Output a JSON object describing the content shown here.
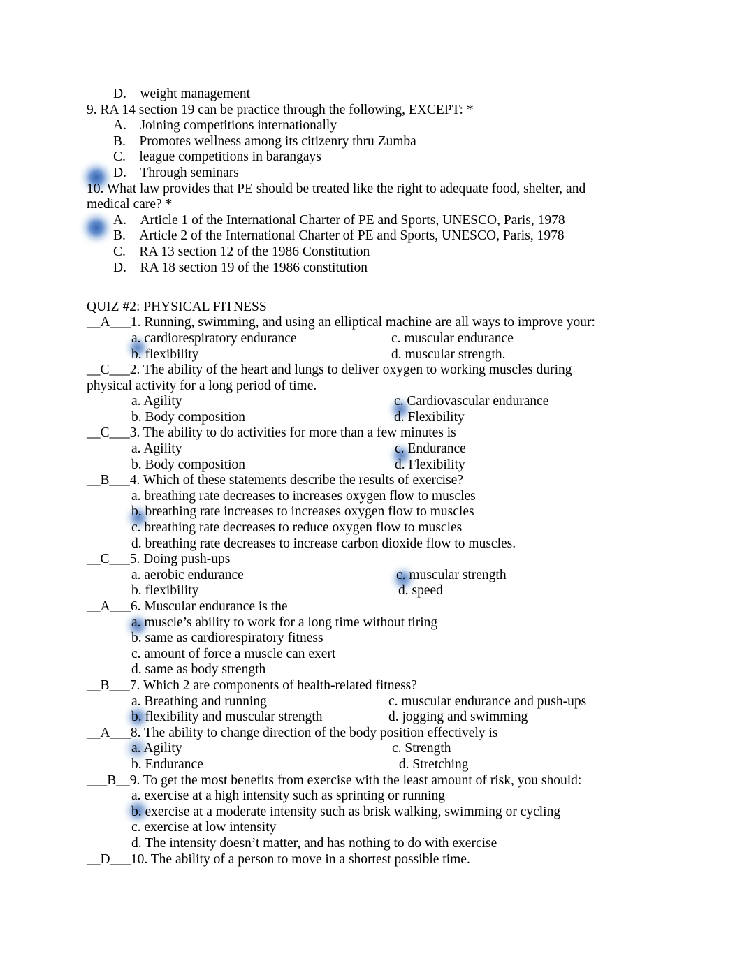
{
  "document": {
    "part1": {
      "trailing_option": "D. weight management",
      "questions": [
        {
          "number": "9.",
          "text": "RA 14 section 19 can be practice through the following, EXCEPT: *",
          "options": [
            "A. Joining competitions internationally",
            "B. Promotes wellness among its citizenry thru Zumba",
            "C. league competitions in barangays",
            "D. Through seminars"
          ]
        },
        {
          "number": "10.",
          "text": "What law provides that PE should be treated like the right to adequate food, shelter, and medical care? *",
          "options": [
            "A. Article 1 of the International Charter of PE and Sports, UNESCO, Paris, 1978",
            "B. Article 2 of the International Charter of PE and Sports, UNESCO, Paris, 1978",
            "C. RA 13 section 12 of the 1986 Constitution",
            "D. RA 18 section 19 of the 1986 constitution"
          ]
        }
      ]
    },
    "quiz2": {
      "title": "QUIZ #2: PHYSICAL FITNESS",
      "items": [
        {
          "blank": "__A___",
          "number": "1.",
          "stem": "Running, swimming, and using an elliptical machine are all ways to improve your:",
          "stem_line2": "",
          "rows": [
            {
              "left": "a. cardiorespiratory endurance",
              "right": "c. muscular endurance"
            },
            {
              "left": "b. flexibility",
              "right": "d. muscular strength."
            }
          ],
          "highlight": "a-left"
        },
        {
          "blank": "__C___",
          "number": "2.",
          "stem": "The ability of the heart and lungs to deliver oxygen to working muscles during",
          "stem_line2": "physical activity for a long period of time.",
          "rows": [
            {
              "left": "a. Agility",
              "right": "c. Cardiovascular endurance"
            },
            {
              "left": "b. Body composition",
              "right": "d. Flexibility"
            }
          ],
          "highlight": "c-right"
        },
        {
          "blank": "__C___",
          "number": "3.",
          "stem": "The ability to do activities for more than a few minutes is",
          "stem_line2": "",
          "rows": [
            {
              "left": "a. Agility",
              "right": "c. Endurance"
            },
            {
              "left": "b. Body composition",
              "right": "d. Flexibility"
            }
          ],
          "highlight": "c-right"
        },
        {
          "blank": "__B___",
          "number": "4.",
          "stem": "Which of these statements describe the results of exercise?",
          "stem_line2": "",
          "rows": [
            {
              "left": "a. breathing rate decreases to increases oxygen flow to muscles",
              "right": ""
            },
            {
              "left": "b. breathing rate increases to increases oxygen flow to muscles",
              "right": ""
            },
            {
              "left": "c. breathing rate decreases to reduce oxygen flow to muscles",
              "right": ""
            },
            {
              "left": "d. breathing rate decreases to increase carbon dioxide flow to muscles.",
              "right": ""
            }
          ],
          "highlight": "b-left"
        },
        {
          "blank": "__C___",
          "number": "5.",
          "stem": "Doing push-ups",
          "stem_line2": "",
          "rows": [
            {
              "left": "a. aerobic endurance",
              "right": "c. muscular strength"
            },
            {
              "left": "b. flexibility",
              "right": "d. speed"
            }
          ],
          "highlight": "c-right"
        },
        {
          "blank": "__A___",
          "number": "6.",
          "stem": "Muscular endurance is the",
          "stem_line2": "",
          "rows": [
            {
              "left": "a. muscle’s ability to work for a long time without tiring",
              "right": ""
            },
            {
              "left": "b. same as cardiorespiratory fitness",
              "right": ""
            },
            {
              "left": "c. amount of force a muscle can exert",
              "right": ""
            },
            {
              "left": "d. same as body strength",
              "right": ""
            }
          ],
          "highlight": "a-left"
        },
        {
          "blank": "__B___",
          "number": "7.",
          "stem": "Which 2 are components of health-related fitness?",
          "stem_line2": "",
          "rows": [
            {
              "left": "a. Breathing and running",
              "right": "c. muscular endurance and push-ups"
            },
            {
              "left": "b. flexibility and muscular strength",
              "right": "d. jogging and swimming"
            }
          ],
          "highlight": "b-left"
        },
        {
          "blank": "__A___",
          "number": "8.",
          "stem": "The ability to change direction of the body position effectively is",
          "stem_line2": "",
          "rows": [
            {
              "left": "a. Agility",
              "right": "c. Strength"
            },
            {
              "left": "b. Endurance",
              "right": " d. Stretching"
            }
          ],
          "highlight": "a-left"
        },
        {
          "blank": "___B__",
          "number": "9.",
          "stem": "To get the most benefits from exercise with the least amount of risk, you should:",
          "stem_line2": "",
          "rows": [
            {
              "left": "a. exercise at a high intensity such as sprinting or running",
              "right": ""
            },
            {
              "left": "b. exercise at a moderate intensity such as brisk walking, swimming or cycling",
              "right": ""
            },
            {
              "left": "c. exercise at low intensity",
              "right": ""
            },
            {
              "left": "d. The intensity doesn’t matter, and has nothing to do with exercise",
              "right": ""
            }
          ],
          "highlight": "b-left"
        },
        {
          "blank": "__D___",
          "number": "10.",
          "stem": "The ability of a person to move in a shortest possible time.",
          "stem_line2": "",
          "rows": [],
          "highlight": ""
        }
      ]
    }
  },
  "colors": {
    "highlight_blue": "#3a6fc0",
    "text": "#000000",
    "page_background": "#ffffff"
  }
}
